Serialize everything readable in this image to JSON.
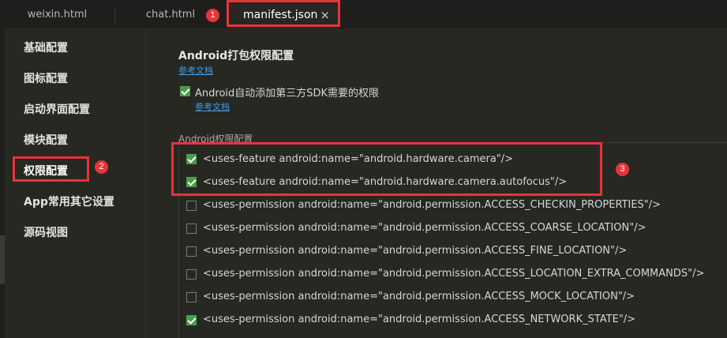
{
  "tabs": [
    {
      "label": "weixin.html"
    },
    {
      "label": "chat.html"
    },
    {
      "label": "manifest.json",
      "close": "×"
    }
  ],
  "sidebar": {
    "items": [
      {
        "label": "基础配置"
      },
      {
        "label": "图标配置"
      },
      {
        "label": "启动界面配置"
      },
      {
        "label": "模块配置"
      },
      {
        "label": "权限配置",
        "active": true
      },
      {
        "label": "App常用其它设置"
      },
      {
        "label": "源码视图"
      }
    ]
  },
  "main": {
    "section_title": "Android打包权限配置",
    "doc_link": "参考文档",
    "auto_sdk": {
      "label": "Android自动添加第三方SDK需要的权限",
      "checked": true,
      "doc_link": "参考文档"
    },
    "permissions_label": "Android权限配置",
    "permissions": [
      {
        "label": "<uses-feature android:name=\"android.hardware.camera\"/>",
        "checked": true
      },
      {
        "label": "<uses-feature android:name=\"android.hardware.camera.autofocus\"/>",
        "checked": true
      },
      {
        "label": "<uses-permission android:name=\"android.permission.ACCESS_CHECKIN_PROPERTIES\"/>",
        "checked": false
      },
      {
        "label": "<uses-permission android:name=\"android.permission.ACCESS_COARSE_LOCATION\"/>",
        "checked": false
      },
      {
        "label": "<uses-permission android:name=\"android.permission.ACCESS_FINE_LOCATION\"/>",
        "checked": false
      },
      {
        "label": "<uses-permission android:name=\"android.permission.ACCESS_LOCATION_EXTRA_COMMANDS\"/>",
        "checked": false
      },
      {
        "label": "<uses-permission android:name=\"android.permission.ACCESS_MOCK_LOCATION\"/>",
        "checked": false
      },
      {
        "label": "<uses-permission android:name=\"android.permission.ACCESS_NETWORK_STATE\"/>",
        "checked": true
      }
    ]
  },
  "annotations": {
    "badge1": "1",
    "badge2": "2",
    "badge3": "3"
  },
  "colors": {
    "annotation": "#e8343a",
    "checkbox_checked": "#4a9d4a",
    "link": "#3f9be8",
    "background": "#272822"
  }
}
